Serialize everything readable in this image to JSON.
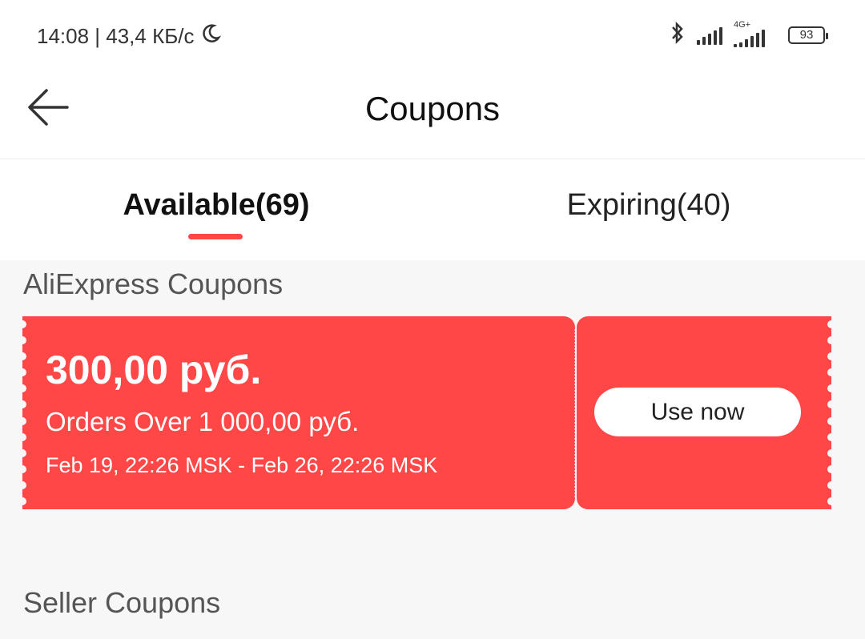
{
  "status_bar": {
    "time_speed": "14:08 | 43,4 КБ/с",
    "network_label": "4G+",
    "battery": "93",
    "icons": [
      "moon-icon",
      "bluetooth-icon",
      "signal-icon",
      "4g-signal-icon",
      "battery-icon"
    ]
  },
  "header": {
    "title": "Coupons",
    "back_icon": "arrow-left-icon"
  },
  "tabs": [
    {
      "label": "Available(69)",
      "active": true
    },
    {
      "label": "Expiring(40)",
      "active": false
    }
  ],
  "sections": {
    "aliexpress_title": "AliExpress Coupons",
    "seller_title": "Seller Coupons"
  },
  "coupon": {
    "amount": "300,00 руб.",
    "condition": "Orders Over 1 000,00 руб.",
    "dates": "Feb 19, 22:26 MSK - Feb 26, 22:26 MSK",
    "button_label": "Use now"
  },
  "colors": {
    "accent": "#ff4747",
    "background": "#f7f7f7"
  }
}
